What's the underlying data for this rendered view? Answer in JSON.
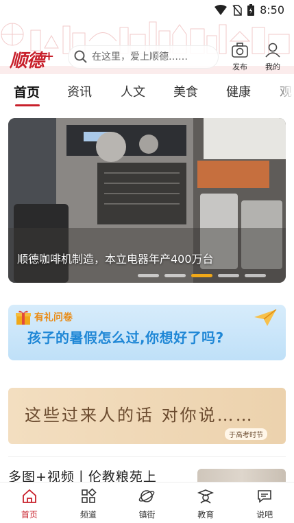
{
  "status_bar": {
    "time": "8:50"
  },
  "header": {
    "logo_text": "顺德",
    "logo_plus": "+",
    "search_placeholder": "在这里，爱上顺德……",
    "publish_label": "发布",
    "mine_label": "我的"
  },
  "tabs": [
    {
      "label": "首页",
      "active": true
    },
    {
      "label": "资讯"
    },
    {
      "label": "人文"
    },
    {
      "label": "美食"
    },
    {
      "label": "健康"
    },
    {
      "label": "观"
    }
  ],
  "banner": {
    "caption": "顺德咖啡机制造，本立电器年产400万台",
    "slide_count": 5,
    "active_slide": 3
  },
  "survey_ad": {
    "tag": "有礼问卷",
    "headline": "孩子的暑假怎么过,你想好了吗?"
  },
  "exam_ad": {
    "title": "这些过来人的话 对你说……",
    "stamp": "于高考时节"
  },
  "news": [
    {
      "title": "多图+视频丨伦教粮苑上"
    }
  ],
  "bottom_nav": [
    {
      "label": "首页",
      "icon": "home-icon",
      "active": true
    },
    {
      "label": "频道",
      "icon": "grid-icon"
    },
    {
      "label": "镇街",
      "icon": "planet-icon"
    },
    {
      "label": "教育",
      "icon": "graduate-icon"
    },
    {
      "label": "说吧",
      "icon": "chat-icon"
    }
  ],
  "colors": {
    "brand_red": "#c8202b",
    "active_dot": "#f0a818",
    "survey_blue": "#1f87d6",
    "survey_orange": "#e98b15"
  }
}
